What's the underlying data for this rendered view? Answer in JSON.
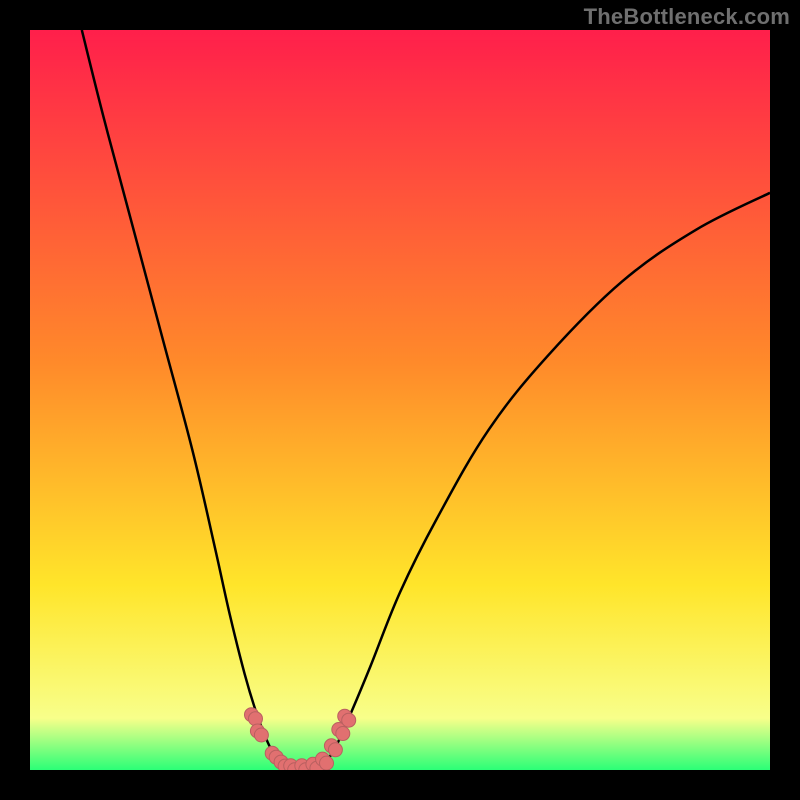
{
  "watermark": "TheBottleneck.com",
  "gradient": {
    "top": "#ff1f4b",
    "mid1": "#ff8a2a",
    "mid2": "#ffe52a",
    "band": "#f8ff8a",
    "bottom": "#2bff77"
  },
  "chart_data": {
    "type": "line",
    "title": "",
    "xlabel": "",
    "ylabel": "",
    "x_range": [
      0,
      100
    ],
    "y_range": [
      0,
      100
    ],
    "series": [
      {
        "name": "left-arm",
        "x": [
          7,
          10,
          14,
          18,
          22,
          25,
          27,
          29,
          30.5,
          31.8,
          33,
          34,
          35
        ],
        "values": [
          100,
          88,
          73,
          58,
          43,
          30,
          21,
          13,
          8,
          4.5,
          2,
          0.8,
          0
        ]
      },
      {
        "name": "right-arm",
        "x": [
          39,
          40,
          41.5,
          43.5,
          46,
          50,
          55,
          62,
          70,
          80,
          90,
          100
        ],
        "values": [
          0,
          1,
          3.5,
          8,
          14,
          24,
          34,
          46,
          56,
          66,
          73,
          78
        ]
      }
    ],
    "markers": {
      "name": "bottom-markers",
      "color": "#e17070",
      "points": [
        {
          "x": 30.2,
          "y": 7.2
        },
        {
          "x": 31.0,
          "y": 5.0
        },
        {
          "x": 33.0,
          "y": 2.0
        },
        {
          "x": 34.2,
          "y": 0.8
        },
        {
          "x": 35.5,
          "y": 0.3
        },
        {
          "x": 37.0,
          "y": 0.3
        },
        {
          "x": 38.5,
          "y": 0.5
        },
        {
          "x": 39.8,
          "y": 1.2
        },
        {
          "x": 41.0,
          "y": 3.0
        },
        {
          "x": 42.0,
          "y": 5.2
        },
        {
          "x": 42.8,
          "y": 7.0
        }
      ]
    }
  }
}
